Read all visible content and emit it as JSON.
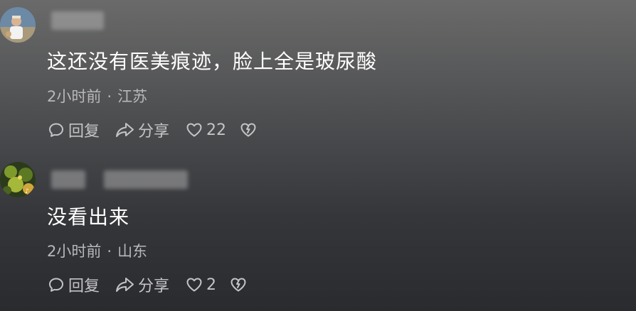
{
  "comments": [
    {
      "text": "这还没有医美痕迹，脸上全是玻尿酸",
      "time": "2小时前",
      "location": "江苏",
      "separator": "·",
      "reply_label": "回复",
      "share_label": "分享",
      "like_count": "22"
    },
    {
      "text": "没看出来",
      "time": "2小时前",
      "location": "山东",
      "separator": "·",
      "reply_label": "回复",
      "share_label": "分享",
      "like_count": "2"
    }
  ],
  "icons": [
    "reply-icon",
    "share-icon",
    "heart-icon",
    "dislike-icon"
  ],
  "colors": {
    "text": "#ffffff",
    "meta": "#b8b8ba",
    "actions": "#c4c4c6"
  }
}
